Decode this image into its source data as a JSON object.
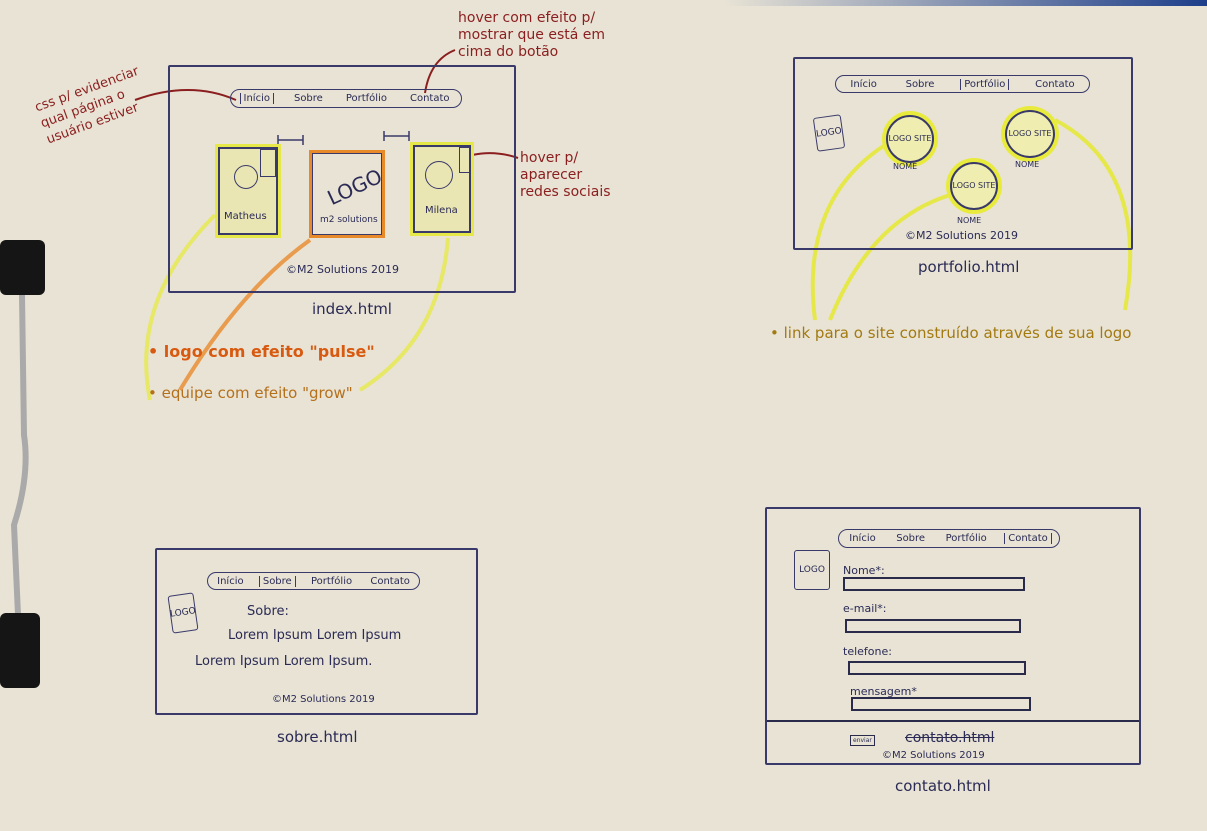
{
  "nav_items": [
    "Início",
    "Sobre",
    "Portfólio",
    "Contato"
  ],
  "footer": "©M2 Solutions 2019",
  "index": {
    "file": "index.html",
    "team": [
      "Matheus",
      "Milena"
    ],
    "logo": "LOGO",
    "logo_caption": "m2 solutions",
    "notes": {
      "active_page": "css p/ evidenciar qual página o usuário estiver",
      "nav_hover": "hover com efeito p/ mostrar que está em cima do botão",
      "social_hover": "hover p/ aparecer redes sociais",
      "logo_pulse": "logo com efeito \"pulse\"",
      "team_grow": "equipe com efeito \"grow\""
    }
  },
  "portfolio": {
    "file": "portfolio.html",
    "logo": "LOGO",
    "site_logo": "LOGO SITE",
    "site_name": "NOME",
    "note": "link para o site construído através de sua logo"
  },
  "sobre": {
    "file": "sobre.html",
    "logo": "LOGO",
    "heading": "Sobre:",
    "lines": [
      "Lorem Ipsum Lorem Ipsum",
      "Lorem Ipsum Lorem Ipsum."
    ]
  },
  "contato": {
    "file": "contato.html",
    "logo": "LOGO",
    "fields": [
      "Nome*:",
      "e-mail*:",
      "telefone:",
      "mensagem*"
    ],
    "submit": "enviar",
    "crossed": "contato.html"
  },
  "colors": {
    "pulse": "#e8892a",
    "grow": "#e6e84a",
    "note": "#8b1e1e",
    "ink": "#2a2a55"
  }
}
